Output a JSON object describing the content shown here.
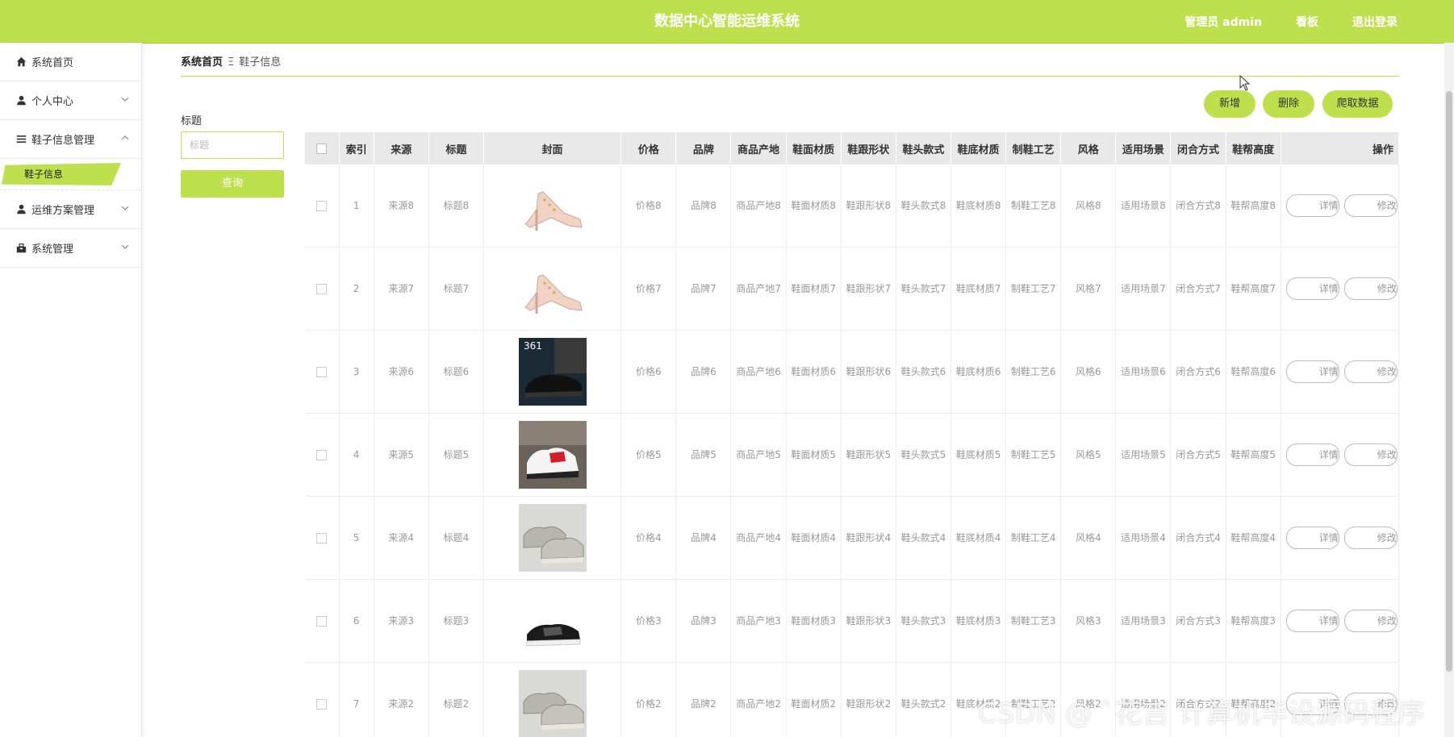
{
  "app": {
    "title": "数据中心智能运维系统",
    "user_label": "管理员 admin",
    "board_label": "看板",
    "logout_label": "退出登录"
  },
  "sidebar": {
    "items": [
      {
        "label": "系统首页",
        "icon": "home-icon"
      },
      {
        "label": "个人中心",
        "icon": "user-icon"
      },
      {
        "label": "鞋子信息管理",
        "icon": "list-icon",
        "expanded": true
      },
      {
        "label": "运维方案管理",
        "icon": "user-icon"
      },
      {
        "label": "系统管理",
        "icon": "toolbox-icon"
      }
    ],
    "active_sub": "鞋子信息"
  },
  "breadcrumb": {
    "home": "系统首页",
    "sep": "Ξ",
    "current": "鞋子信息"
  },
  "actions": {
    "add": "新增",
    "delete": "删除",
    "crawl": "爬取数据"
  },
  "filter": {
    "label": "标题",
    "placeholder": "标题",
    "query": "查询"
  },
  "table": {
    "headers": [
      "索引",
      "来源",
      "标题",
      "封面",
      "价格",
      "品牌",
      "商品产地",
      "鞋面材质",
      "鞋跟形状",
      "鞋头款式",
      "鞋底材质",
      "制鞋工艺",
      "风格",
      "适用场景",
      "闭合方式",
      "鞋帮高度",
      "操作"
    ],
    "op_detail": "详情",
    "op_edit": "修改",
    "rows": [
      {
        "idx": "1",
        "source": "来源8",
        "title": "标题8",
        "cover": "heel-pink",
        "price": "价格8",
        "brand": "品牌8",
        "origin": "商品产地8",
        "upper": "鞋面材质8",
        "heel": "鞋跟形状8",
        "toe": "鞋头款式8",
        "sole": "鞋底材质8",
        "craft": "制鞋工艺8",
        "style": "风格8",
        "scene": "适用场景8",
        "closure": "闭合方式8",
        "height": "鞋帮高度8"
      },
      {
        "idx": "2",
        "source": "来源7",
        "title": "标题7",
        "cover": "heel-pink",
        "price": "价格7",
        "brand": "品牌7",
        "origin": "商品产地7",
        "upper": "鞋面材质7",
        "heel": "鞋跟形状7",
        "toe": "鞋头款式7",
        "sole": "鞋底材质7",
        "craft": "制鞋工艺7",
        "style": "风格7",
        "scene": "适用场景7",
        "closure": "闭合方式7",
        "height": "鞋帮高度7"
      },
      {
        "idx": "3",
        "source": "来源6",
        "title": "标题6",
        "cover": "sneaker-black-361",
        "price": "价格6",
        "brand": "品牌6",
        "origin": "商品产地6",
        "upper": "鞋面材质6",
        "heel": "鞋跟形状6",
        "toe": "鞋头款式6",
        "sole": "鞋底材质6",
        "craft": "制鞋工艺6",
        "style": "风格6",
        "scene": "适用场景6",
        "closure": "闭合方式6",
        "height": "鞋帮高度6"
      },
      {
        "idx": "4",
        "source": "来源5",
        "title": "标题5",
        "cover": "sneaker-white-red",
        "price": "价格5",
        "brand": "品牌5",
        "origin": "商品产地5",
        "upper": "鞋面材质5",
        "heel": "鞋跟形状5",
        "toe": "鞋头款式5",
        "sole": "鞋底材质5",
        "craft": "制鞋工艺5",
        "style": "风格5",
        "scene": "适用场景5",
        "closure": "闭合方式5",
        "height": "鞋帮高度5"
      },
      {
        "idx": "5",
        "source": "来源4",
        "title": "标题4",
        "cover": "sneaker-silver",
        "price": "价格4",
        "brand": "品牌4",
        "origin": "商品产地4",
        "upper": "鞋面材质4",
        "heel": "鞋跟形状4",
        "toe": "鞋头款式4",
        "sole": "鞋底材质4",
        "craft": "制鞋工艺4",
        "style": "风格4",
        "scene": "适用场景4",
        "closure": "闭合方式4",
        "height": "鞋帮高度4"
      },
      {
        "idx": "6",
        "source": "来源3",
        "title": "标题3",
        "cover": "sneaker-low-black",
        "price": "价格3",
        "brand": "品牌3",
        "origin": "商品产地3",
        "upper": "鞋面材质3",
        "heel": "鞋跟形状3",
        "toe": "鞋头款式3",
        "sole": "鞋底材质3",
        "craft": "制鞋工艺3",
        "style": "风格3",
        "scene": "适用场景3",
        "closure": "闭合方式3",
        "height": "鞋帮高度3"
      },
      {
        "idx": "7",
        "source": "来源2",
        "title": "标题2",
        "cover": "sneaker-silver",
        "price": "价格2",
        "brand": "品牌2",
        "origin": "商品产地2",
        "upper": "鞋面材质2",
        "heel": "鞋跟形状2",
        "toe": "鞋头款式2",
        "sole": "鞋底材质2",
        "craft": "制鞋工艺2",
        "style": "风格2",
        "scene": "适用场景2",
        "closure": "闭合方式2",
        "height": "鞋帮高度2"
      }
    ]
  },
  "watermark": "CSDN @ `花吉 计算机毕设源码程序",
  "colors": {
    "accent": "#bfe04d",
    "header_bg": "#e9e9e9"
  }
}
